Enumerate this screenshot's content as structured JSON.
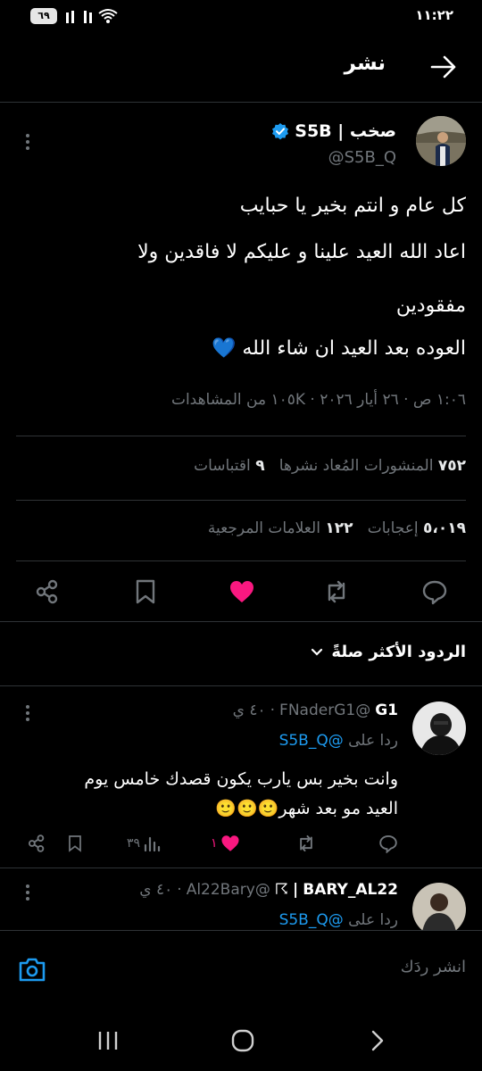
{
  "status_bar": {
    "time": "١١:٢٢",
    "battery": "٦٩"
  },
  "header": {
    "title": "نشر"
  },
  "tweet": {
    "author_name": "صخب | S5B",
    "author_handle": "@S5B_Q",
    "lines": [
      "كل عام و انتم بخير يا حبايب",
      "اعاد الله العيد علينا و عليكم لا فاقدين ولا",
      "مفقودين",
      "العوده بعد العيد ان شاء الله 💙"
    ],
    "meta": "١:٠٦ ص · ٢٦ أيار ٢٠٢٦ · ١٠٥K من المشاهدات",
    "stats_row1": {
      "reposts_count": "٧٥٢",
      "reposts_label": "المنشورات المُعاد نشرها",
      "quotes_count": "٩",
      "quotes_label": "اقتباسات"
    },
    "stats_row2": {
      "likes_count": "٥،٠١٩",
      "likes_label": "إعجابات",
      "bookmarks_count": "١٢٢",
      "bookmarks_label": "العلامات المرجعية"
    }
  },
  "sort": {
    "label": "الردود الأكثر صلةً"
  },
  "replies": [
    {
      "name": "G1",
      "handle": "@FNaderG1",
      "time": "٤٠ ي",
      "replying_prefix": "ردا على",
      "replying_to": "@S5B_Q",
      "text_lines": [
        "وانت بخير بس يارب يكون قصدك خامس يوم",
        "العيد مو بعد شهر🙂🙂🙂"
      ],
      "views": "٣٩",
      "likes": "١"
    },
    {
      "name": "BARY_AL22",
      "badge": "☈",
      "handle": "@Al22Bary",
      "time": "٤٠ ي",
      "replying_prefix": "ردا على",
      "replying_to": "@S5B_Q"
    }
  ],
  "compose": {
    "placeholder": "انشر ردَك"
  },
  "colors": {
    "background": "#000000",
    "text": "#e7e9ea",
    "muted": "#71767b",
    "accent": "#1d9bf0",
    "like": "#f91880",
    "verified": "#1d9bf0"
  }
}
